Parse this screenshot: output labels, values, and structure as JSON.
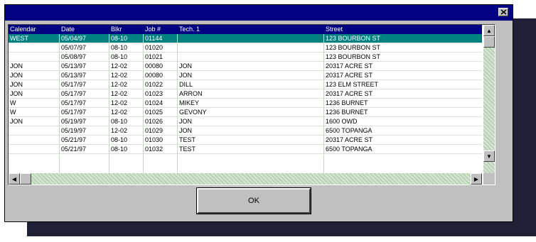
{
  "dialog": {
    "ok_label": "OK"
  },
  "table": {
    "columns": [
      "Calendar",
      "Date",
      "Blkr",
      "Job #",
      "Tech. 1",
      "Street"
    ],
    "rows": [
      [
        "WEST",
        "05/04/97",
        "08-10",
        "01144",
        "",
        "123 BOURBON ST"
      ],
      [
        "",
        "05/07/97",
        "08-10",
        "01020",
        "",
        "123 BOURBON ST"
      ],
      [
        "",
        "05/08/97",
        "08-10",
        "01021",
        "",
        "123 BOURBON ST"
      ],
      [
        "JON",
        "05/13/97",
        "12-02",
        "00080",
        "JON",
        "20317 ACRE ST"
      ],
      [
        "JON",
        "05/13/97",
        "12-02",
        "00080",
        "JON",
        "20317 ACRE ST"
      ],
      [
        "JON",
        "05/17/97",
        "12-02",
        "01022",
        "DILL",
        "123 ELM STREET"
      ],
      [
        "JON",
        "05/17/97",
        "12-02",
        "01023",
        "ARRON",
        "20317 ACRE ST"
      ],
      [
        "W",
        "05/17/97",
        "12-02",
        "01024",
        "MIKEY",
        "1236 BURNET"
      ],
      [
        "W",
        "05/17/97",
        "12-02",
        "01025",
        "GEVONY",
        "1236 BURNET"
      ],
      [
        "JON",
        "05/19/97",
        "08-10",
        "01026",
        "JON",
        "1600 OWD"
      ],
      [
        "",
        "05/19/97",
        "12-02",
        "01029",
        "JON",
        "6500 TOPANGA"
      ],
      [
        "",
        "05/21/97",
        "08-10",
        "01030",
        "TEST",
        "20317 ACRE ST"
      ],
      [
        "",
        "05/21/97",
        "08-10",
        "01032",
        "TEST",
        "6500 TOPANGA"
      ]
    ],
    "selected_row": 0
  },
  "colors": {
    "titlebar": "#000080",
    "header": "#000080",
    "selected_row": "#008080",
    "dialog_face": "#c0c0c0"
  },
  "icons": {
    "close": "close-icon",
    "up": "arrow-up-icon",
    "down": "arrow-down-icon",
    "left": "arrow-left-icon",
    "right": "arrow-right-icon"
  }
}
